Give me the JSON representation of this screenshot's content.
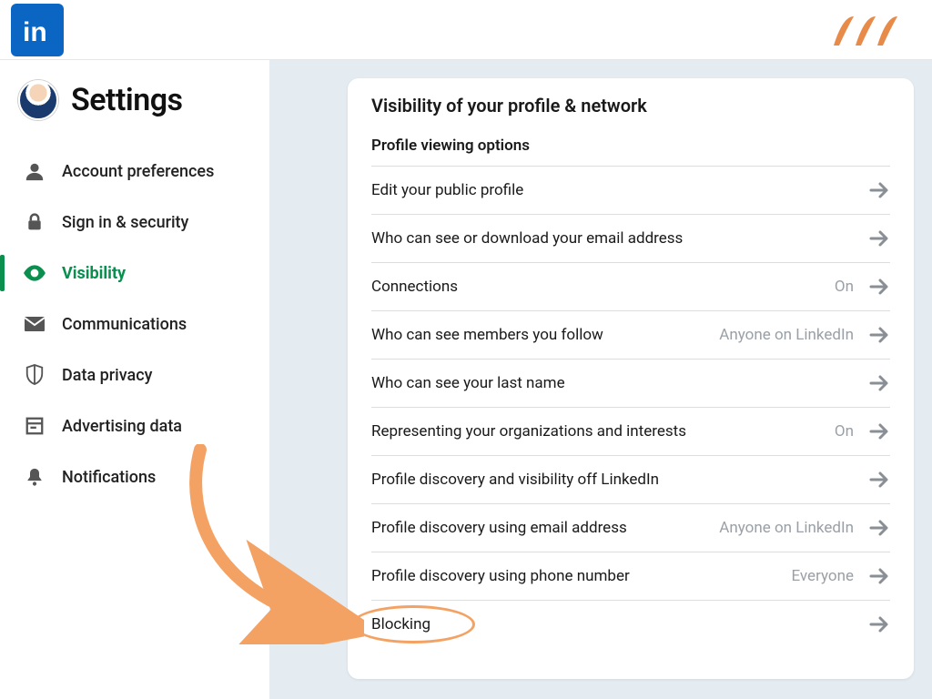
{
  "header": {
    "linkedin_text": "in"
  },
  "sidebar": {
    "title": "Settings",
    "items": [
      {
        "label": "Account preferences",
        "icon": "user-icon",
        "active": false
      },
      {
        "label": "Sign in & security",
        "icon": "lock-icon",
        "active": false
      },
      {
        "label": "Visibility",
        "icon": "eye-icon",
        "active": true
      },
      {
        "label": "Communications",
        "icon": "mail-icon",
        "active": false
      },
      {
        "label": "Data privacy",
        "icon": "shield-icon",
        "active": false
      },
      {
        "label": "Advertising data",
        "icon": "doc-icon",
        "active": false
      },
      {
        "label": "Notifications",
        "icon": "bell-icon",
        "active": false
      }
    ]
  },
  "panel": {
    "title": "Visibility of your profile & network",
    "subheader": "Profile viewing options",
    "rows": [
      {
        "label": "Edit your public profile",
        "status": ""
      },
      {
        "label": "Who can see or download your email address",
        "status": ""
      },
      {
        "label": "Connections",
        "status": "On"
      },
      {
        "label": "Who can see members you follow",
        "status": "Anyone on LinkedIn"
      },
      {
        "label": "Who can see your last name",
        "status": ""
      },
      {
        "label": "Representing your organizations and interests",
        "status": "On"
      },
      {
        "label": "Profile discovery and visibility off LinkedIn",
        "status": ""
      },
      {
        "label": "Profile discovery using email address",
        "status": "Anyone on LinkedIn"
      },
      {
        "label": "Profile discovery using phone number",
        "status": "Everyone"
      },
      {
        "label": "Blocking",
        "status": ""
      }
    ]
  },
  "annotation": {
    "highlight_row_index": 9
  },
  "colors": {
    "accent_green": "#0a8f4f",
    "annotation_orange": "#f4a264",
    "linkedin_blue": "#0a66c2"
  }
}
